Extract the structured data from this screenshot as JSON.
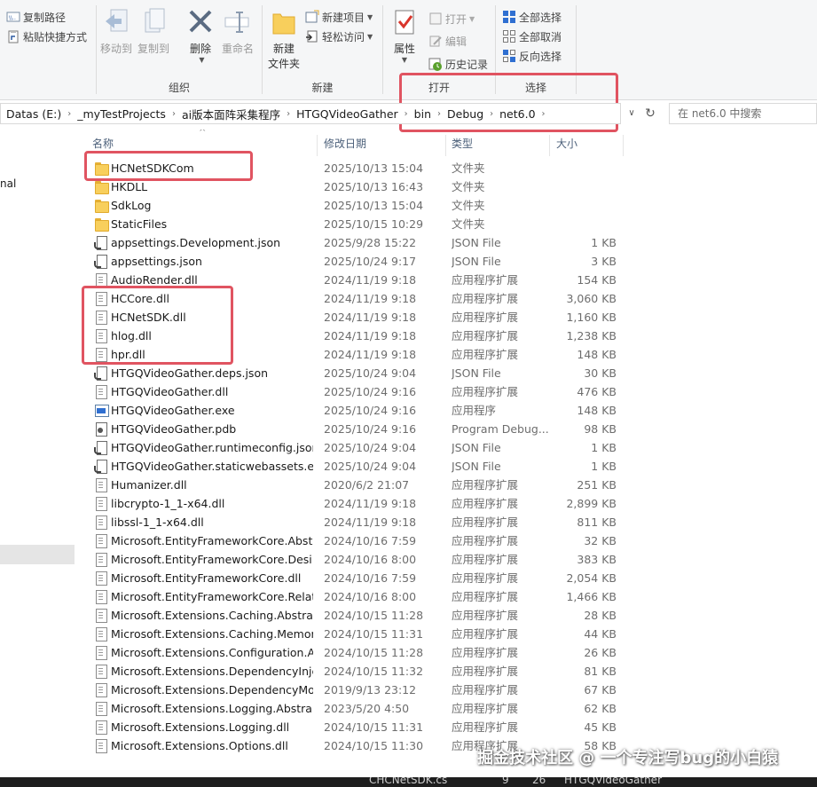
{
  "ribbon": {
    "clipboard": {
      "copy_path": "复制路径",
      "paste_shortcut": "粘贴快捷方式"
    },
    "organize": {
      "label": "组织",
      "move_to": "移动到",
      "copy_to": "复制到",
      "delete": "删除",
      "rename": "重命名"
    },
    "new": {
      "label": "新建",
      "new_folder_line1": "新建",
      "new_folder_line2": "文件夹",
      "new_item": "新建项目",
      "easy_access": "轻松访问"
    },
    "open": {
      "label": "打开",
      "properties": "属性",
      "open": "打开",
      "edit": "编辑",
      "history": "历史记录"
    },
    "select": {
      "label": "选择",
      "select_all": "全部选择",
      "select_none": "全部取消",
      "invert": "反向选择"
    }
  },
  "address": {
    "crumbs": [
      "Datas (E:)",
      "_myTestProjects",
      "ai版本面阵采集程序",
      "HTGQVideoGather",
      "bin",
      "Debug",
      "net6.0"
    ],
    "search_placeholder": "在 net6.0 中搜索"
  },
  "nav": {
    "partial_item": "nal"
  },
  "columns": {
    "name": "名称",
    "date": "修改日期",
    "type": "类型",
    "size": "大小"
  },
  "files": [
    {
      "name": "HCNetSDKCom",
      "date": "2025/10/13 15:04",
      "type": "文件夹",
      "size": "",
      "icon": "folder-icon"
    },
    {
      "name": "HKDLL",
      "date": "2025/10/13 16:43",
      "type": "文件夹",
      "size": "",
      "icon": "folder-icon"
    },
    {
      "name": "SdkLog",
      "date": "2025/10/13 15:04",
      "type": "文件夹",
      "size": "",
      "icon": "folder-icon"
    },
    {
      "name": "StaticFiles",
      "date": "2025/10/15 10:29",
      "type": "文件夹",
      "size": "",
      "icon": "folder-icon"
    },
    {
      "name": "appsettings.Development.json",
      "date": "2025/9/28 15:22",
      "type": "JSON File",
      "size": "1 KB",
      "icon": "json-file-icon"
    },
    {
      "name": "appsettings.json",
      "date": "2025/10/24 9:17",
      "type": "JSON File",
      "size": "3 KB",
      "icon": "json-file-icon"
    },
    {
      "name": "AudioRender.dll",
      "date": "2024/11/19 9:18",
      "type": "应用程序扩展",
      "size": "154 KB",
      "icon": "dll-file-icon"
    },
    {
      "name": "HCCore.dll",
      "date": "2024/11/19 9:18",
      "type": "应用程序扩展",
      "size": "3,060 KB",
      "icon": "dll-file-icon"
    },
    {
      "name": "HCNetSDK.dll",
      "date": "2024/11/19 9:18",
      "type": "应用程序扩展",
      "size": "1,160 KB",
      "icon": "dll-file-icon"
    },
    {
      "name": "hlog.dll",
      "date": "2024/11/19 9:18",
      "type": "应用程序扩展",
      "size": "1,238 KB",
      "icon": "dll-file-icon"
    },
    {
      "name": "hpr.dll",
      "date": "2024/11/19 9:18",
      "type": "应用程序扩展",
      "size": "148 KB",
      "icon": "dll-file-icon"
    },
    {
      "name": "HTGQVideoGather.deps.json",
      "date": "2025/10/24 9:04",
      "type": "JSON File",
      "size": "30 KB",
      "icon": "json-file-icon"
    },
    {
      "name": "HTGQVideoGather.dll",
      "date": "2025/10/24 9:16",
      "type": "应用程序扩展",
      "size": "476 KB",
      "icon": "dll-file-icon"
    },
    {
      "name": "HTGQVideoGather.exe",
      "date": "2025/10/24 9:16",
      "type": "应用程序",
      "size": "148 KB",
      "icon": "exe-file-icon"
    },
    {
      "name": "HTGQVideoGather.pdb",
      "date": "2025/10/24 9:16",
      "type": "Program Debug...",
      "size": "98 KB",
      "icon": "pdb-file-icon"
    },
    {
      "name": "HTGQVideoGather.runtimeconfig.json",
      "date": "2025/10/24 9:04",
      "type": "JSON File",
      "size": "1 KB",
      "icon": "json-file-icon"
    },
    {
      "name": "HTGQVideoGather.staticwebassets.e...",
      "date": "2025/10/24 9:04",
      "type": "JSON File",
      "size": "1 KB",
      "icon": "json-file-icon"
    },
    {
      "name": "Humanizer.dll",
      "date": "2020/6/2 21:07",
      "type": "应用程序扩展",
      "size": "251 KB",
      "icon": "dll-file-icon"
    },
    {
      "name": "libcrypto-1_1-x64.dll",
      "date": "2024/11/19 9:18",
      "type": "应用程序扩展",
      "size": "2,899 KB",
      "icon": "dll-file-icon"
    },
    {
      "name": "libssl-1_1-x64.dll",
      "date": "2024/11/19 9:18",
      "type": "应用程序扩展",
      "size": "811 KB",
      "icon": "dll-file-icon"
    },
    {
      "name": "Microsoft.EntityFrameworkCore.Abstr...",
      "date": "2024/10/16 7:59",
      "type": "应用程序扩展",
      "size": "32 KB",
      "icon": "dll-file-icon"
    },
    {
      "name": "Microsoft.EntityFrameworkCore.Desi...",
      "date": "2024/10/16 8:00",
      "type": "应用程序扩展",
      "size": "383 KB",
      "icon": "dll-file-icon"
    },
    {
      "name": "Microsoft.EntityFrameworkCore.dll",
      "date": "2024/10/16 7:59",
      "type": "应用程序扩展",
      "size": "2,054 KB",
      "icon": "dll-file-icon"
    },
    {
      "name": "Microsoft.EntityFrameworkCore.Relat...",
      "date": "2024/10/16 8:00",
      "type": "应用程序扩展",
      "size": "1,466 KB",
      "icon": "dll-file-icon"
    },
    {
      "name": "Microsoft.Extensions.Caching.Abstrac...",
      "date": "2024/10/15 11:28",
      "type": "应用程序扩展",
      "size": "28 KB",
      "icon": "dll-file-icon"
    },
    {
      "name": "Microsoft.Extensions.Caching.Memor...",
      "date": "2024/10/15 11:31",
      "type": "应用程序扩展",
      "size": "44 KB",
      "icon": "dll-file-icon"
    },
    {
      "name": "Microsoft.Extensions.Configuration.A...",
      "date": "2024/10/15 11:28",
      "type": "应用程序扩展",
      "size": "26 KB",
      "icon": "dll-file-icon"
    },
    {
      "name": "Microsoft.Extensions.DependencyInje...",
      "date": "2024/10/15 11:32",
      "type": "应用程序扩展",
      "size": "81 KB",
      "icon": "dll-file-icon"
    },
    {
      "name": "Microsoft.Extensions.DependencyMo...",
      "date": "2019/9/13 23:12",
      "type": "应用程序扩展",
      "size": "67 KB",
      "icon": "dll-file-icon"
    },
    {
      "name": "Microsoft.Extensions.Logging.Abstra...",
      "date": "2023/5/20 4:50",
      "type": "应用程序扩展",
      "size": "62 KB",
      "icon": "dll-file-icon"
    },
    {
      "name": "Microsoft.Extensions.Logging.dll",
      "date": "2024/10/15 11:31",
      "type": "应用程序扩展",
      "size": "45 KB",
      "icon": "dll-file-icon"
    },
    {
      "name": "Microsoft.Extensions.Options.dll",
      "date": "2024/10/15 11:30",
      "type": "应用程序扩展",
      "size": "58 KB",
      "icon": "dll-file-icon"
    }
  ],
  "taskbar": {
    "file": "CHCNetSDK.cs",
    "line": "9",
    "col": "26",
    "project": "HTGQVideoGather"
  },
  "watermark": "掘金技术社区 @ 一个专注写bug的小白猿",
  "colors": {
    "highlight": "#e05461",
    "header_text": "#4c607a",
    "folder": "#f8cf5c"
  }
}
